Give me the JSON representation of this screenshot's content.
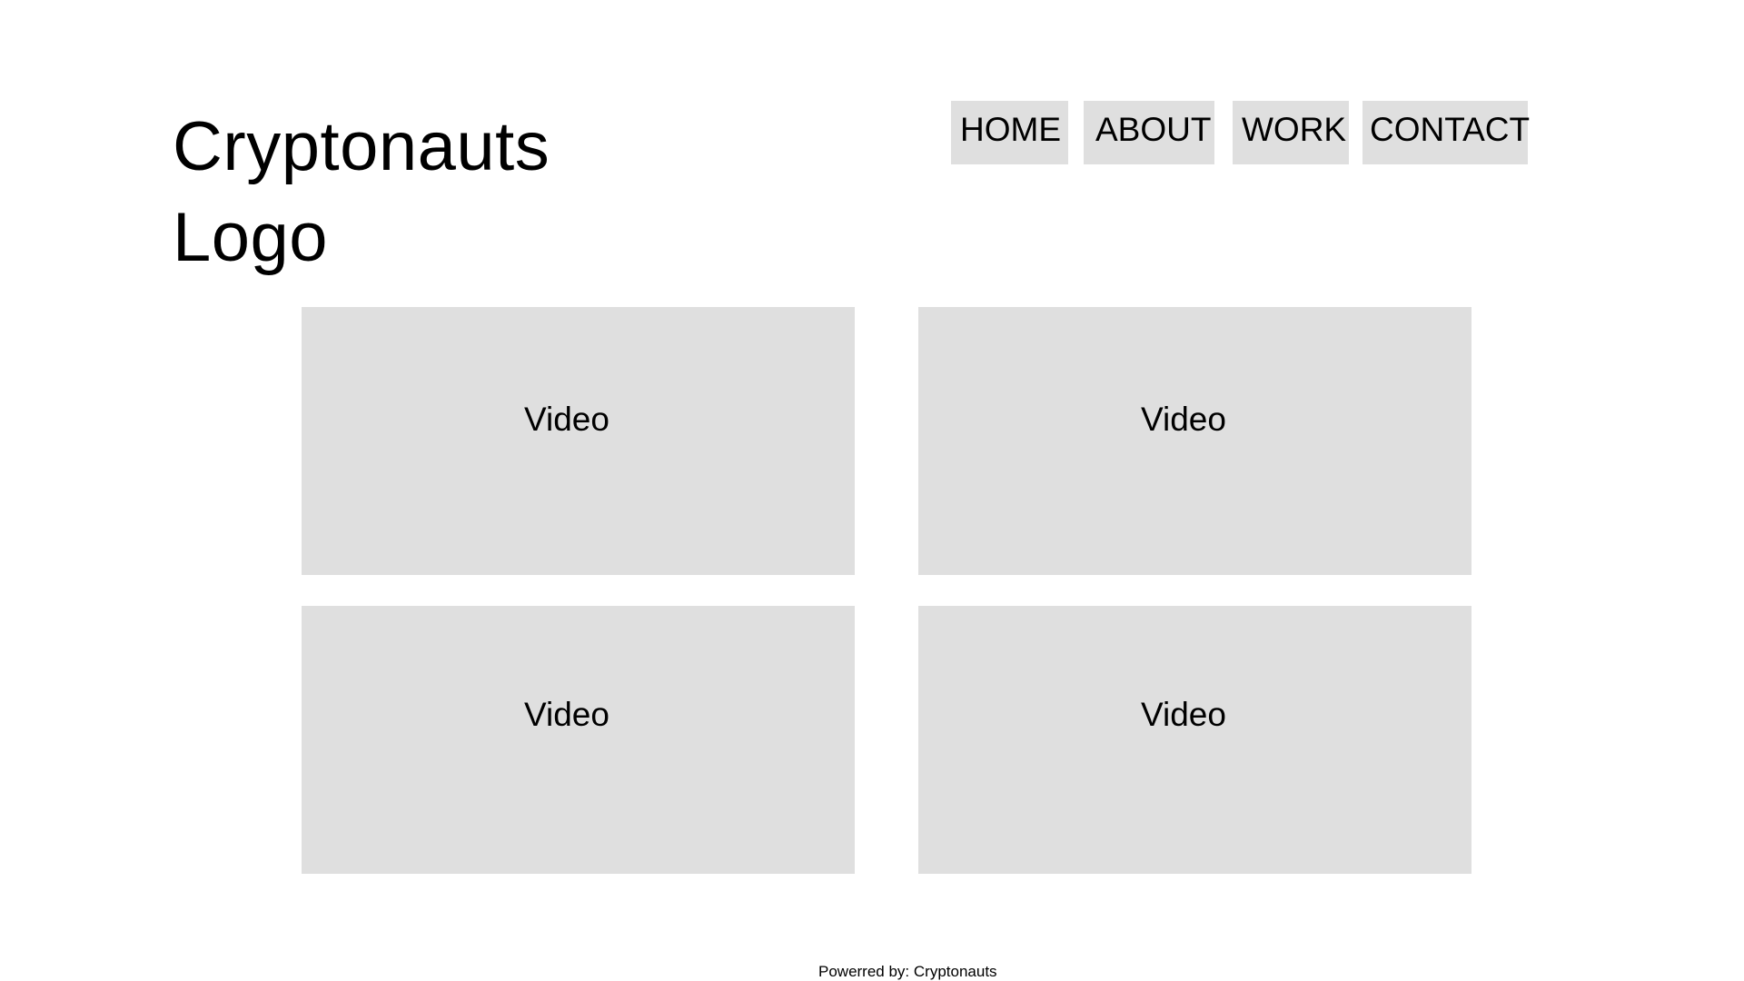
{
  "header": {
    "logo_text": "Cryptonauts Logo"
  },
  "nav": {
    "items": [
      {
        "label": "HOME"
      },
      {
        "label": "ABOUT"
      },
      {
        "label": "WORK"
      },
      {
        "label": "CONTACT"
      }
    ]
  },
  "videos": [
    {
      "label": "Video"
    },
    {
      "label": "Video"
    },
    {
      "label": "Video"
    },
    {
      "label": "Video"
    }
  ],
  "footer": {
    "text": "Powerred by: Cryptonauts"
  },
  "colors": {
    "background": "#ffffff",
    "placeholder": "#dfdfdf",
    "text": "#000000"
  }
}
